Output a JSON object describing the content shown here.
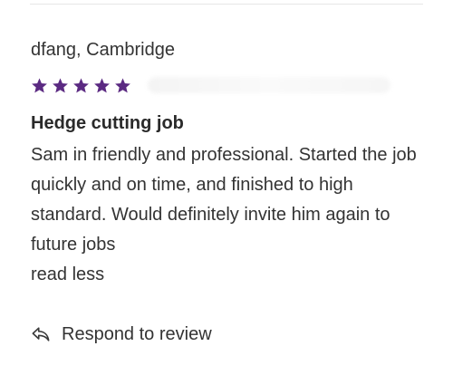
{
  "review": {
    "author": "dfang, Cambridge",
    "rating": 5,
    "max_rating": 5,
    "star_color": "#5b2a82",
    "title": "Hedge cutting job",
    "body": "Sam in friendly and professional. Started the job quickly and on time, and finished to high standard. Would definitely invite him again to future jobs",
    "toggle_label": "read less"
  },
  "actions": {
    "respond_label": "Respond to review",
    "respond_icon": "reply-icon"
  }
}
